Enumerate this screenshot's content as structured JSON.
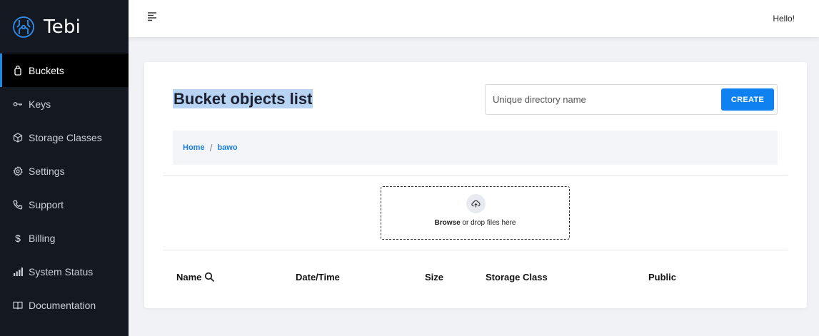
{
  "brand": {
    "name": "Tebi"
  },
  "sidebar": {
    "items": [
      {
        "label": "Buckets",
        "icon": "bucket-icon",
        "active": true
      },
      {
        "label": "Keys",
        "icon": "key-icon"
      },
      {
        "label": "Storage Classes",
        "icon": "cube-icon"
      },
      {
        "label": "Settings",
        "icon": "gear-icon"
      },
      {
        "label": "Support",
        "icon": "phone-icon"
      },
      {
        "label": "Billing",
        "icon": "dollar-icon"
      },
      {
        "label": "System Status",
        "icon": "signal-bars-icon"
      },
      {
        "label": "Documentation",
        "icon": "book-icon"
      }
    ]
  },
  "topbar": {
    "greeting": "Hello!"
  },
  "main": {
    "title": "Bucket objects list",
    "directory_input": {
      "placeholder": "Unique directory name",
      "value": ""
    },
    "create_label": "CREATE",
    "breadcrumb": {
      "items": [
        "Home",
        "bawo"
      ],
      "separator": "/"
    },
    "dropzone": {
      "browse_label": "Browse",
      "rest_label": " or drop files here"
    },
    "table": {
      "columns": [
        "Name",
        "Date/Time",
        "Size",
        "Storage Class",
        "Public"
      ]
    }
  },
  "colors": {
    "accent": "#1081f0",
    "sidebar_bg": "#141821",
    "title_highlight": "#b9d4f2"
  }
}
